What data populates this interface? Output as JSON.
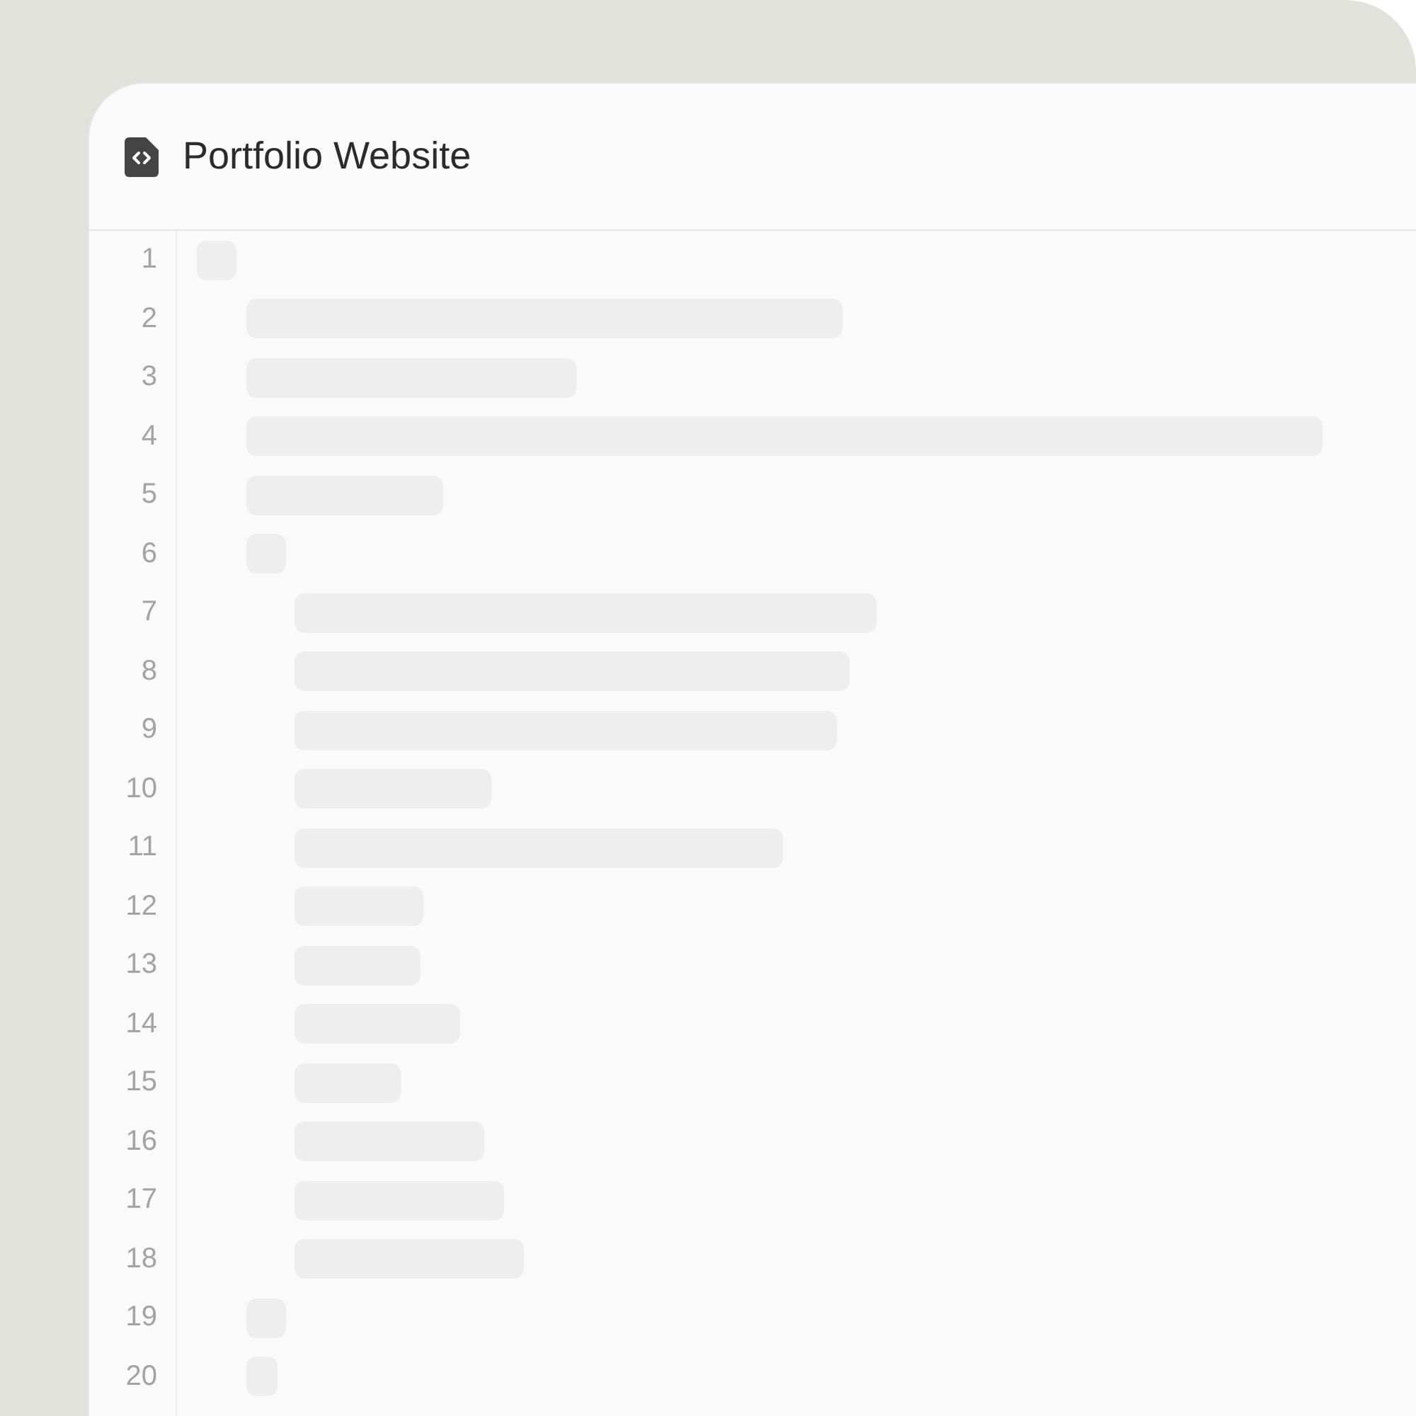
{
  "window": {
    "title": "Portfolio Website"
  },
  "editor": {
    "lines": [
      {
        "number": "1",
        "children": [
          {
            "number": "2"
          },
          {
            "number": "3"
          },
          {
            "number": "4"
          },
          {
            "number": "5"
          },
          {
            "number": "6",
            "children": [
              {
                "number": "7"
              },
              {
                "number": "8"
              },
              {
                "number": "9"
              },
              {
                "number": "10"
              },
              {
                "number": "11"
              },
              {
                "number": "12"
              },
              {
                "number": "13"
              },
              {
                "number": "14"
              },
              {
                "number": "15"
              },
              {
                "number": "16"
              },
              {
                "number": "17"
              },
              {
                "number": "18"
              }
            ]
          },
          {
            "number": "19"
          },
          {
            "number": "20"
          }
        ]
      }
    ]
  }
}
